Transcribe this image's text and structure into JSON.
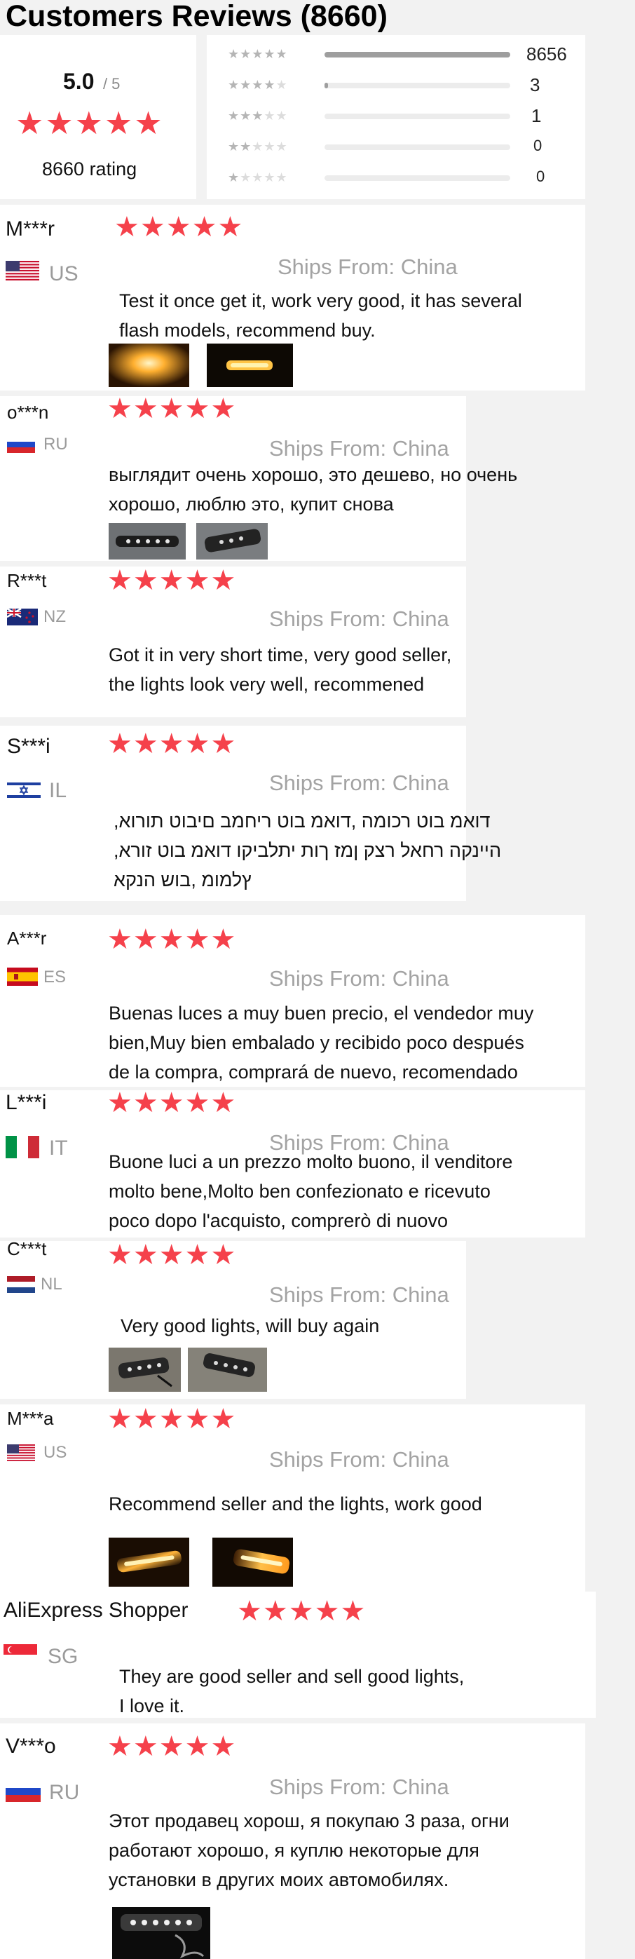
{
  "header": {
    "title": "Customers Reviews (8660)"
  },
  "summary": {
    "average": "5.0",
    "out_of": "/ 5",
    "rating_label": "8660 rating",
    "star_icon": "star-icon",
    "breakdown": [
      {
        "stars": 5,
        "count": "8656",
        "fill_fraction": 0.9995
      },
      {
        "stars": 4,
        "count": "3",
        "fill_fraction": 0.02
      },
      {
        "stars": 3,
        "count": "1",
        "fill_fraction": 0.0
      },
      {
        "stars": 2,
        "count": "0",
        "fill_fraction": 0.0
      },
      {
        "stars": 1,
        "count": "0",
        "fill_fraction": 0.0
      }
    ]
  },
  "reviews": [
    {
      "name": "M***r",
      "country": "US",
      "flag": "us-flag-icon",
      "rating": 5,
      "ships_from": "Ships From: China",
      "text_lines": [
        "Test it once get it, work very good, it has several",
        "flash models, recommend buy."
      ],
      "photos": 2
    },
    {
      "name": "o***n",
      "country": "RU",
      "flag": "ru-flag-icon",
      "rating": 5,
      "ships_from": "Ships From: China",
      "text_lines": [
        "выглядит очень хорошо, это дешево, но очень",
        "хорошо, люблю это, купит снова"
      ],
      "photos": 2
    },
    {
      "name": "R***t",
      "country": "NZ",
      "flag": "nz-flag-icon",
      "rating": 5,
      "ships_from": "Ships From: China",
      "text_lines": [
        "Got it in very short time, very good seller,",
        "the lights look very well, recommened"
      ],
      "photos": 0
    },
    {
      "name": "S***i",
      "country": "IL",
      "flag": "il-flag-icon",
      "rating": 5,
      "ships_from": "Ships From: China",
      "text_lines": [
        "דואמ בוט רכומה ,דואמ בוט ריחמב םיבוט תורוא,",
        "היינקה רחאל רצק ןמז ךות יתלביקו דואמ בוט זורא,",
        "ץלמומ ,בוש הנקא"
      ],
      "photos": 0
    },
    {
      "name": "A***r",
      "country": "ES",
      "flag": "es-flag-icon",
      "rating": 5,
      "ships_from": "Ships From: China",
      "text_lines": [
        "Buenas luces a muy buen precio, el vendedor muy",
        "bien,Muy bien embalado y recibido poco después",
        "de la compra, comprará de nuevo, recomendado"
      ],
      "photos": 0
    },
    {
      "name": "L***i",
      "country": "IT",
      "flag": "it-flag-icon",
      "rating": 5,
      "ships_from": "Ships From: China",
      "text_lines": [
        "Buone luci a un prezzo molto buono, il venditore",
        "molto bene,Molto ben confezionato e ricevuto",
        "poco dopo l'acquisto, comprerò di nuovo"
      ],
      "photos": 0
    },
    {
      "name": "C***t",
      "country": "NL",
      "flag": "nl-flag-icon",
      "rating": 5,
      "ships_from": "Ships From: China",
      "text_lines": [
        "Very good lights, will buy again"
      ],
      "photos": 2
    },
    {
      "name": "M***a",
      "country": "US",
      "flag": "us-flag-icon",
      "rating": 5,
      "ships_from": "Ships From: China",
      "text_lines": [
        "Recommend seller and the lights, work good"
      ],
      "photos": 2
    },
    {
      "name": "AliExpress Shopper",
      "country": "SG",
      "flag": "sg-flag-icon",
      "rating": 5,
      "ships_from": "",
      "text_lines": [
        "They are good seller and sell good lights,",
        "I love it."
      ],
      "photos": 0
    },
    {
      "name": "V***o",
      "country": "RU",
      "flag": "ru-flag-icon",
      "rating": 5,
      "ships_from": "Ships From: China",
      "text_lines": [
        "Этот продавец хорош, я покупаю 3 раза, огни",
        "работают хорошо, я куплю некоторые для",
        "установки в других моих автомобилях."
      ],
      "photos": 1
    }
  ],
  "colors": {
    "star": "#f5414b",
    "muted": "#a3a3a3",
    "bar": "#9e9e9e"
  }
}
